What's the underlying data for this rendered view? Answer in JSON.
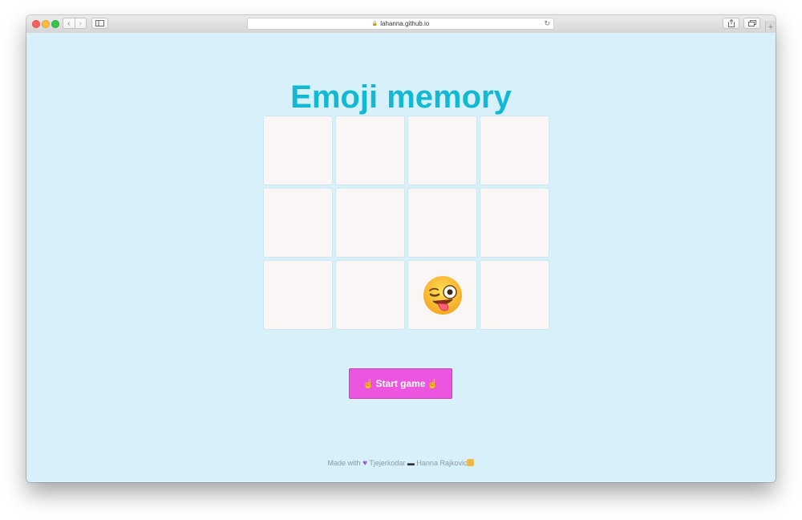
{
  "browser": {
    "url": "lahanna.github.io",
    "back_icon": "chevron-left-icon",
    "forward_icon": "chevron-right-icon",
    "sidebar_icon": "sidebar-icon",
    "share_icon": "share-icon",
    "tabs_icon": "tabs-icon",
    "new_tab": "+"
  },
  "page": {
    "title": "Emoji memory",
    "cards": [
      {
        "face": ""
      },
      {
        "face": ""
      },
      {
        "face": ""
      },
      {
        "face": ""
      },
      {
        "face": ""
      },
      {
        "face": ""
      },
      {
        "face": ""
      },
      {
        "face": ""
      },
      {
        "face": ""
      },
      {
        "face": ""
      },
      {
        "face": "winking-face-with-tongue"
      },
      {
        "face": ""
      }
    ],
    "start_button": {
      "label": "Start game",
      "left_icon": "pointing-hand-icon",
      "right_icon": "pointing-hand-icon"
    },
    "footer": {
      "made_with": "Made with",
      "tjejerkodar": "Tjejerkodar",
      "author": "Hanna Rajkovic"
    }
  },
  "colors": {
    "background": "#d8f0f9",
    "title": "#12b9d3",
    "button": "#eb55e0"
  }
}
